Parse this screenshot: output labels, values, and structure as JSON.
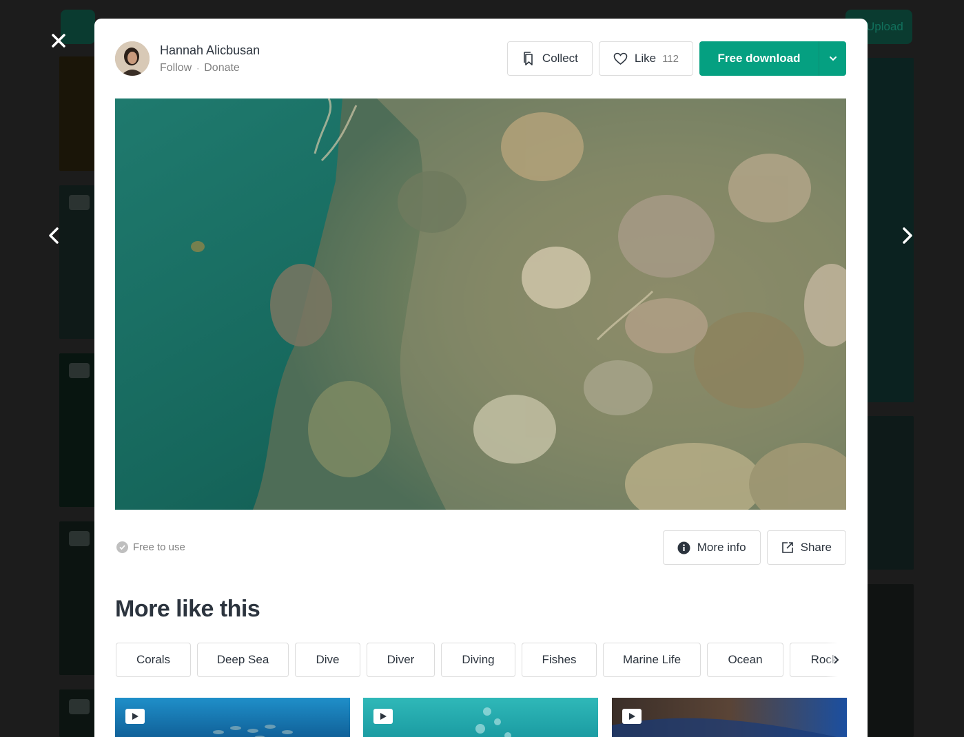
{
  "background": {
    "upload_label": "Upload"
  },
  "author": {
    "name": "Hannah Alicbusan",
    "follow_label": "Follow",
    "separator": "·",
    "donate_label": "Donate"
  },
  "actions": {
    "collect_label": "Collect",
    "like_label": "Like",
    "like_count": "112",
    "download_label": "Free download"
  },
  "media": {
    "description_icon": "underwater-coral-reef-video"
  },
  "license": {
    "free_label": "Free to use"
  },
  "info": {
    "more_info_label": "More info",
    "share_label": "Share"
  },
  "related": {
    "title": "More like this",
    "tags": [
      "Corals",
      "Deep Sea",
      "Dive",
      "Diver",
      "Diving",
      "Fishes",
      "Marine Life",
      "Ocean",
      "Rock"
    ]
  },
  "colors": {
    "accent": "#05a081",
    "overlay": "#1c1c1c",
    "text": "#2c343e",
    "muted": "#7f7f7f"
  },
  "icons": [
    "close-icon",
    "chevron-left-icon",
    "chevron-right-icon",
    "bookmark-icon",
    "heart-icon",
    "chevron-down-icon",
    "check-icon",
    "info-icon",
    "share-icon",
    "play-icon"
  ]
}
